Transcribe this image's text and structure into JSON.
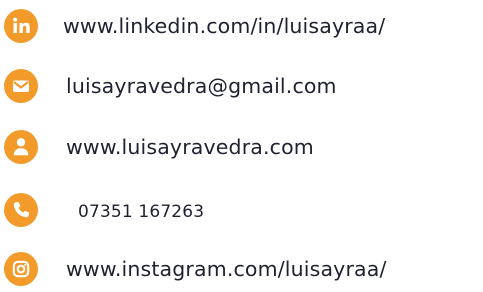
{
  "accent_color": "#f29b2b",
  "contacts": [
    {
      "icon": "linkedin-icon",
      "text": "www.linkedin.com/in/luisayraa/"
    },
    {
      "icon": "email-icon",
      "text": "luisayravedra@gmail.com"
    },
    {
      "icon": "person-icon",
      "text": "www.luisayravedra.com"
    },
    {
      "icon": "phone-icon",
      "text": "07351 167263"
    },
    {
      "icon": "instagram-icon",
      "text": "www.instagram.com/luisayraa/"
    }
  ]
}
